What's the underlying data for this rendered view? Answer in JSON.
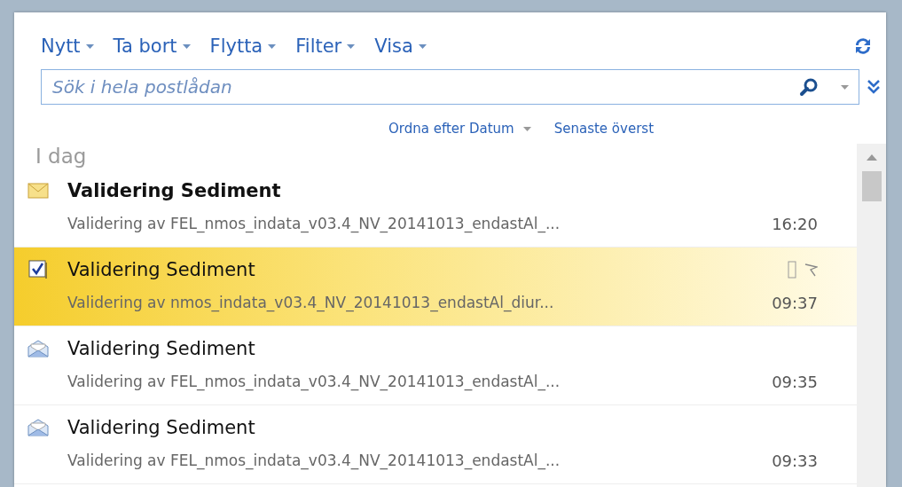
{
  "toolbar": {
    "menus": [
      {
        "label": "Nytt"
      },
      {
        "label": "Ta bort"
      },
      {
        "label": "Flytta"
      },
      {
        "label": "Filter"
      },
      {
        "label": "Visa"
      }
    ]
  },
  "search": {
    "placeholder": "Sök i hela postlådan"
  },
  "sort": {
    "order_by": "Ordna efter Datum",
    "direction": "Senaste överst"
  },
  "group": {
    "label": "I dag"
  },
  "messages": [
    {
      "kind": "unread",
      "subject": "Validering Sediment",
      "preview": "Validering av FEL_nmos_indata_v03.4_NV_20141013_endastAl_...",
      "time": "16:20",
      "selected": false
    },
    {
      "kind": "checked",
      "subject": "Validering Sediment",
      "preview": "Validering av nmos_indata_v03.4_NV_20141013_endastAl_diur...",
      "time": "09:37",
      "selected": true
    },
    {
      "kind": "read",
      "subject": "Validering Sediment",
      "preview": "Validering av FEL_nmos_indata_v03.4_NV_20141013_endastAl_...",
      "time": "09:35",
      "selected": false
    },
    {
      "kind": "read",
      "subject": "Validering Sediment",
      "preview": "Validering av FEL_nmos_indata_v03.4_NV_20141013_endastAl_...",
      "time": "09:33",
      "selected": false
    }
  ]
}
